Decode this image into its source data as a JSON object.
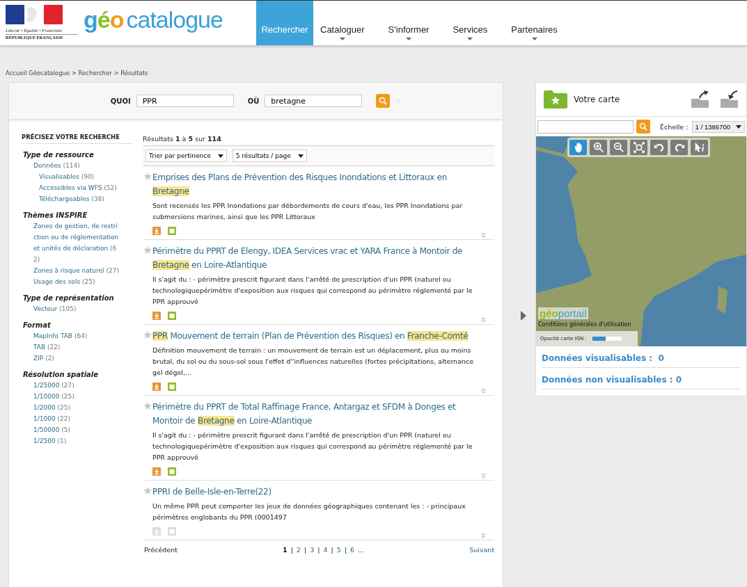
{
  "header": {
    "motto": "Liberté • Égalité • Fraternité",
    "republic": "RÉPUBLIQUE FRANÇAISE",
    "brand": "géo",
    "brand_suffix": "catalogue",
    "nav": [
      {
        "label": "Rechercher",
        "selected": true,
        "dropdown": false
      },
      {
        "label": "Cataloguer",
        "selected": false,
        "dropdown": true
      },
      {
        "label": "S'informer",
        "selected": false,
        "dropdown": true
      },
      {
        "label": "Services",
        "selected": false,
        "dropdown": true
      },
      {
        "label": "Partenaires",
        "selected": false,
        "dropdown": true
      }
    ]
  },
  "breadcrumb": "Accueil Géocatalogue > Rechercher > Résultats",
  "search": {
    "what_label": "QUOI",
    "what_value": "PPR",
    "where_label": "OÙ",
    "where_value": "bretagne"
  },
  "facets": {
    "title": "PRÉCISEZ VOTRE RECHERCHE",
    "groups": [
      {
        "title": "Type de ressource",
        "items": [
          {
            "label": "Données",
            "count": "(114)",
            "children": [
              {
                "label": "Visualisables",
                "count": "(90)"
              },
              {
                "label": "Accessibles via WFS",
                "count": "(52)"
              },
              {
                "label": "Téléchargeables",
                "count": "(38)"
              }
            ]
          }
        ]
      },
      {
        "title": "Thèmes INSPIRE",
        "items": [
          {
            "label": "Zones de gestion, de restriction ou de réglementation et unités de déclaration",
            "count": "(62)"
          },
          {
            "label": "Zones à risque naturel",
            "count": "(27)"
          },
          {
            "label": "Usage des sols",
            "count": "(25)"
          }
        ]
      },
      {
        "title": "Type de représentation",
        "items": [
          {
            "label": "Vecteur",
            "count": "(105)"
          }
        ]
      },
      {
        "title": "Format",
        "items": [
          {
            "label": "MapInfo TAB",
            "count": "(64)"
          },
          {
            "label": "TAB",
            "count": "(22)"
          },
          {
            "label": "ZIP",
            "count": "(2)"
          }
        ]
      },
      {
        "title": "Résolution spatiale",
        "items": [
          {
            "label": "1/25000",
            "count": "(27)"
          },
          {
            "label": "1/10000",
            "count": "(25)"
          },
          {
            "label": "1/2000",
            "count": "(25)"
          },
          {
            "label": "1/1000",
            "count": "(22)"
          },
          {
            "label": "1/50000",
            "count": "(5)"
          },
          {
            "label": "1/2500",
            "count": "(1)"
          }
        ]
      }
    ]
  },
  "results": {
    "summary": "Résultats **1** à **5** sur **114**",
    "sort": "Trier par pertinence",
    "per_page": "5 résultats / page",
    "items": [
      {
        "title": [
          {
            "text": "Emprises des Plans de Prévention des Risques Inondations et Littoraux en ",
            "highlighted": false
          },
          {
            "text": "Bretagne",
            "highlighted": true
          }
        ],
        "description": "Sont recensés les PPR Inondations par débordements de cours d'eau, les PPR Inondations par submersions marines, ainsi que les PPR Littoraux",
        "available": true
      },
      {
        "title": [
          {
            "text": "Périmètre du PPRT de Elengy, IDEA Services vrac et YARA France à Montoir de ",
            "highlighted": false
          },
          {
            "text": "Bretagne",
            "highlighted": true
          },
          {
            "text": " en Loire-Atlantique",
            "highlighted": false
          }
        ],
        "description": "Il s'agit du : - périmètre prescrit figurant dans l'arrêté de prescription d'un PPR (naturel ou technologiquepérimètre d'exposition aux risques qui correspond au périmètre réglementé par le PPR approuvé",
        "available": true
      },
      {
        "title": [
          {
            "text": "PPR",
            "highlighted": true
          },
          {
            "text": " Mouvement de terrain (Plan de Prévention des Risques) en ",
            "highlighted": false
          },
          {
            "text": "Franche-Comté",
            "highlighted": true
          }
        ],
        "description": "Définition mouvement de terrain : un mouvement de terrain est un déplacement, plus ou moins brutal, du sol ou du sous-sol sous l'effet d''influences naturelles (fortes précipitations, alternance gel dégel,...",
        "available": true
      },
      {
        "title": [
          {
            "text": "Périmètre du PPRT de Total Raffinage France, Antargaz et SFDM à Donges et Montoir de ",
            "highlighted": false
          },
          {
            "text": "Bretagne",
            "highlighted": true
          },
          {
            "text": " en Loire-Atlantique",
            "highlighted": false
          }
        ],
        "description": "Il s'agit du : - périmètre prescrit figurant dans l'arrêté de prescription d'un PPR (naturel ou technologiquepérimètre d'exposition aux risques qui correspond au périmètre réglementé par le PPR approuvé",
        "available": true
      },
      {
        "title": [
          {
            "text": "PPRI de Belle-Isle-en-Terre(22)",
            "highlighted": false
          }
        ],
        "description": "Un même PPR peut comporter les jeux de données géographiques contenant les : - principaux périmètres englobants du PPR (0001497",
        "available": false
      }
    ],
    "pagination": {
      "previous": "Précédent",
      "pages": [
        {
          "label": "1",
          "selected": true
        },
        {
          "label": "2",
          "selected": false
        },
        {
          "label": "3",
          "selected": false
        },
        {
          "label": "4",
          "selected": false
        },
        {
          "label": "5",
          "selected": false
        },
        {
          "label": "6",
          "selected": false
        }
      ],
      "separator": "|",
      "ellipsis": "...",
      "next": "Suivant"
    }
  },
  "map_panel": {
    "title": "Votre carte",
    "scale_label": "Échelle :",
    "scale_value": "1 / 1386700",
    "tools": [
      {
        "kind": "pan",
        "selected": true
      },
      {
        "kind": "zoom-in",
        "selected": false
      },
      {
        "kind": "zoom-out",
        "selected": false
      },
      {
        "kind": "extent",
        "selected": false
      },
      {
        "kind": "undo",
        "selected": false
      },
      {
        "kind": "redo",
        "selected": false
      },
      {
        "kind": "info",
        "selected": false
      }
    ],
    "map_brand": "géoportail",
    "terms": "Conditions générales d'utilisation",
    "opacity_label": "Opacité carte IGN :",
    "opacity": {
      "level": 0.45
    },
    "visible_data": "Données visualisables :  0",
    "hidden_data": "Données non visualisables : 0"
  }
}
